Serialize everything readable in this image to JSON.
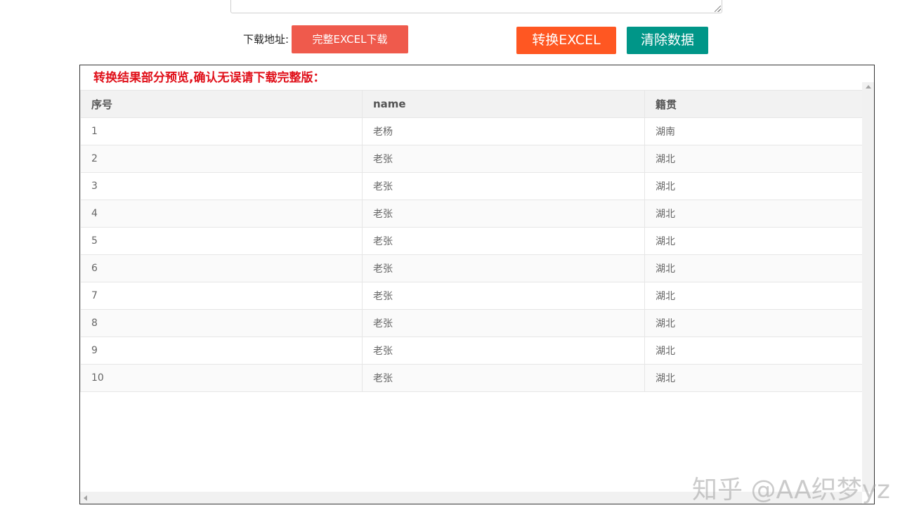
{
  "toolbar": {
    "download_label": "下载地址:",
    "download_button": "完整EXCEL下载",
    "convert_button": "转换EXCEL",
    "clear_button": "清除数据"
  },
  "preview": {
    "title": "转换结果部分预览,确认无误请下载完整版：",
    "columns": [
      "序号",
      "name",
      "籍贯"
    ],
    "rows": [
      [
        "1",
        "老杨",
        "湖南"
      ],
      [
        "2",
        "老张",
        "湖北"
      ],
      [
        "3",
        "老张",
        "湖北"
      ],
      [
        "4",
        "老张",
        "湖北"
      ],
      [
        "5",
        "老张",
        "湖北"
      ],
      [
        "6",
        "老张",
        "湖北"
      ],
      [
        "7",
        "老张",
        "湖北"
      ],
      [
        "8",
        "老张",
        "湖北"
      ],
      [
        "9",
        "老张",
        "湖北"
      ],
      [
        "10",
        "老张",
        "湖北"
      ]
    ]
  },
  "watermark": "知乎 @AA织梦yz",
  "colors": {
    "download_button": "#ef5a4c",
    "convert_button": "#ff5722",
    "clear_button": "#009688",
    "title": "#e0101a"
  }
}
